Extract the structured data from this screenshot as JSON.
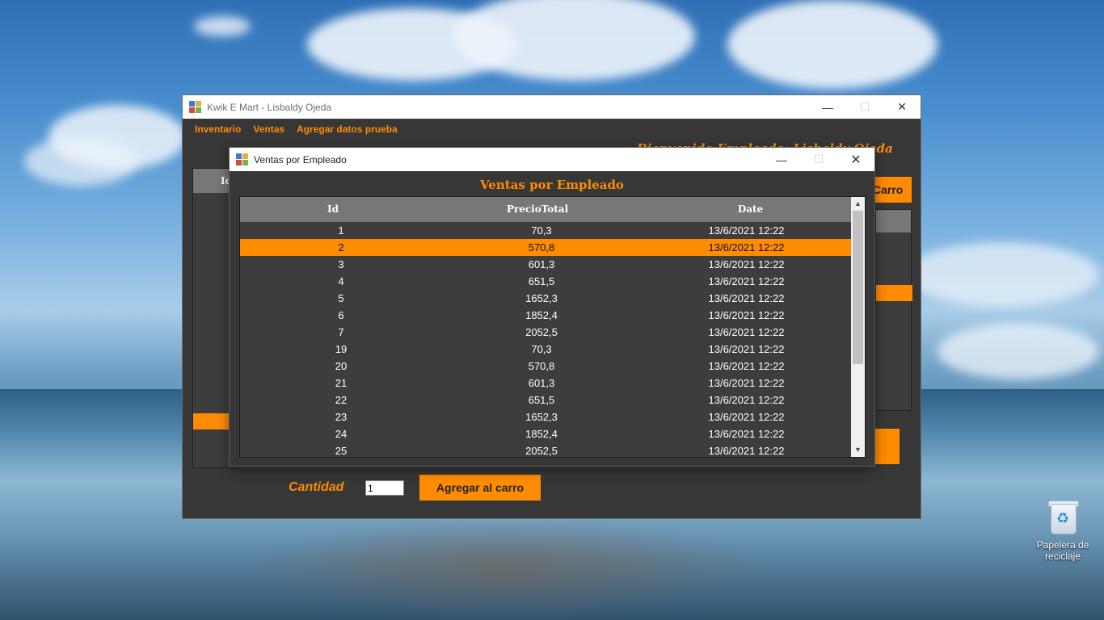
{
  "desktop": {
    "recycle_bin_label": "Papelera de reciclaje"
  },
  "main_window": {
    "title": "Kwik E Mart - Lisbaldy Ojeda",
    "menu": [
      "Inventario",
      "Ventas",
      "Agregar datos prueba"
    ],
    "greeting_partial": "Bienvenido Empleado: Lisbaldy Ojeda",
    "left_grid_header_partial": "Id",
    "carro_button_partial": "Carro",
    "cantidad_label": "Cantidad",
    "cantidad_value": "1",
    "agregar_button": "Agregar al carro"
  },
  "dialog": {
    "title": "Ventas por Empleado",
    "heading": "Ventas por Empleado",
    "columns": [
      "Id",
      "PrecioTotal",
      "Date"
    ],
    "selected_row_index": 1,
    "rows": [
      {
        "id": "1",
        "precio": "70,3",
        "date": "13/6/2021 12:22"
      },
      {
        "id": "2",
        "precio": "570,8",
        "date": "13/6/2021 12:22"
      },
      {
        "id": "3",
        "precio": "601,3",
        "date": "13/6/2021 12:22"
      },
      {
        "id": "4",
        "precio": "651,5",
        "date": "13/6/2021 12:22"
      },
      {
        "id": "5",
        "precio": "1652,3",
        "date": "13/6/2021 12:22"
      },
      {
        "id": "6",
        "precio": "1852,4",
        "date": "13/6/2021 12:22"
      },
      {
        "id": "7",
        "precio": "2052,5",
        "date": "13/6/2021 12:22"
      },
      {
        "id": "19",
        "precio": "70,3",
        "date": "13/6/2021 12:22"
      },
      {
        "id": "20",
        "precio": "570,8",
        "date": "13/6/2021 12:22"
      },
      {
        "id": "21",
        "precio": "601,3",
        "date": "13/6/2021 12:22"
      },
      {
        "id": "22",
        "precio": "651,5",
        "date": "13/6/2021 12:22"
      },
      {
        "id": "23",
        "precio": "1652,3",
        "date": "13/6/2021 12:22"
      },
      {
        "id": "24",
        "precio": "1852,4",
        "date": "13/6/2021 12:22"
      },
      {
        "id": "25",
        "precio": "2052,5",
        "date": "13/6/2021 12:22"
      }
    ]
  },
  "colors": {
    "accent": "#ff8c00",
    "window_bg": "#373737",
    "grid_bg": "#3d3d3d",
    "header_bg": "#777777"
  },
  "icons": {
    "minimize": "minimize-icon",
    "maximize": "maximize-icon",
    "close": "close-icon",
    "app": "app-icon",
    "recycle_bin": "recycle-bin-icon"
  }
}
